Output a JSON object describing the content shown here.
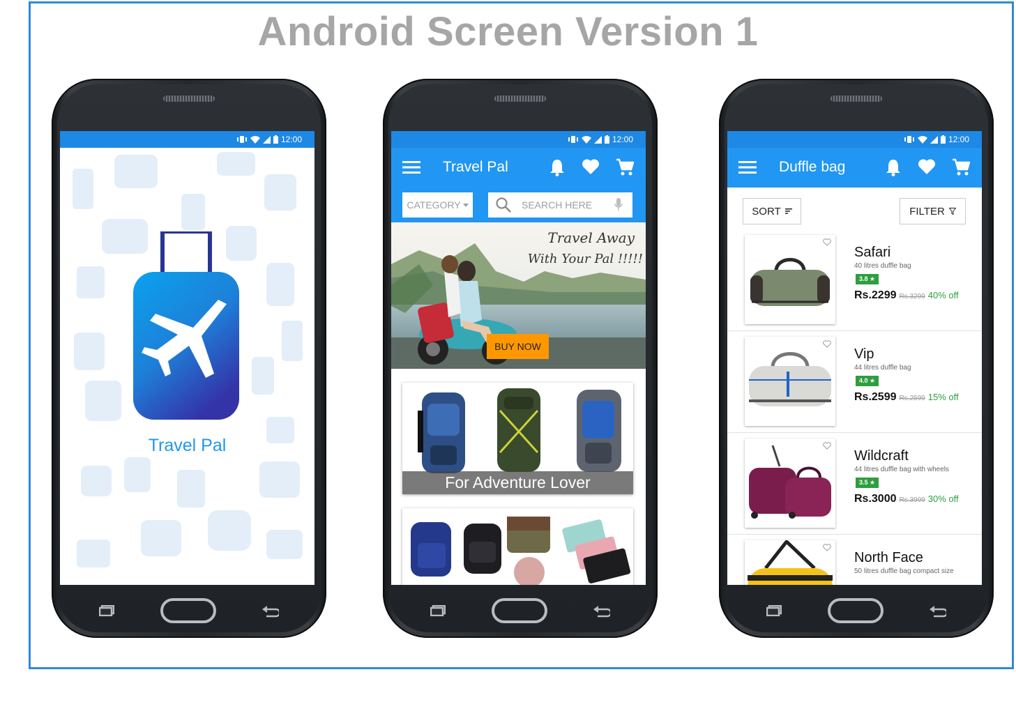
{
  "page_title": "Android Screen Version 1",
  "status": {
    "time": "12:00"
  },
  "splash": {
    "app_name": "Travel Pal"
  },
  "home": {
    "toolbar_title": "Travel Pal",
    "category_label": "CATEGORY",
    "search_placeholder": "SEARCH HERE",
    "banner_line1": "Travel Away",
    "banner_line2": "With Your Pal !!!!!",
    "buy_now": "BUY NOW",
    "card1_caption": "For Adventure Lover"
  },
  "list": {
    "toolbar_title": "Duffle bag",
    "sort_label": "SORT",
    "filter_label": "FILTER",
    "items": [
      {
        "name": "Safari",
        "desc": "40 litres duffle bag",
        "rating": "3.8 ★",
        "price": "Rs.2299",
        "mrp": "Rs.3299",
        "off": "40% off"
      },
      {
        "name": "Vip",
        "desc": "44 litres duffle bag",
        "rating": "4.0 ★",
        "price": "Rs.2599",
        "mrp": "Rs.2599",
        "off": "15% off"
      },
      {
        "name": "Wildcraft",
        "desc": "44 litres duffle bag with wheels",
        "rating": "3.5 ★",
        "price": "Rs.3000",
        "mrp": "Rs.3999",
        "off": "30% off"
      },
      {
        "name": "North Face",
        "desc": "50 litres duffle bag compact size"
      }
    ]
  },
  "colors": {
    "primary": "#2196f3",
    "status_bar": "#1e88e5",
    "accent": "#ff9800",
    "rating_green": "#2e9e3e",
    "frame_border": "#2f88dd"
  }
}
